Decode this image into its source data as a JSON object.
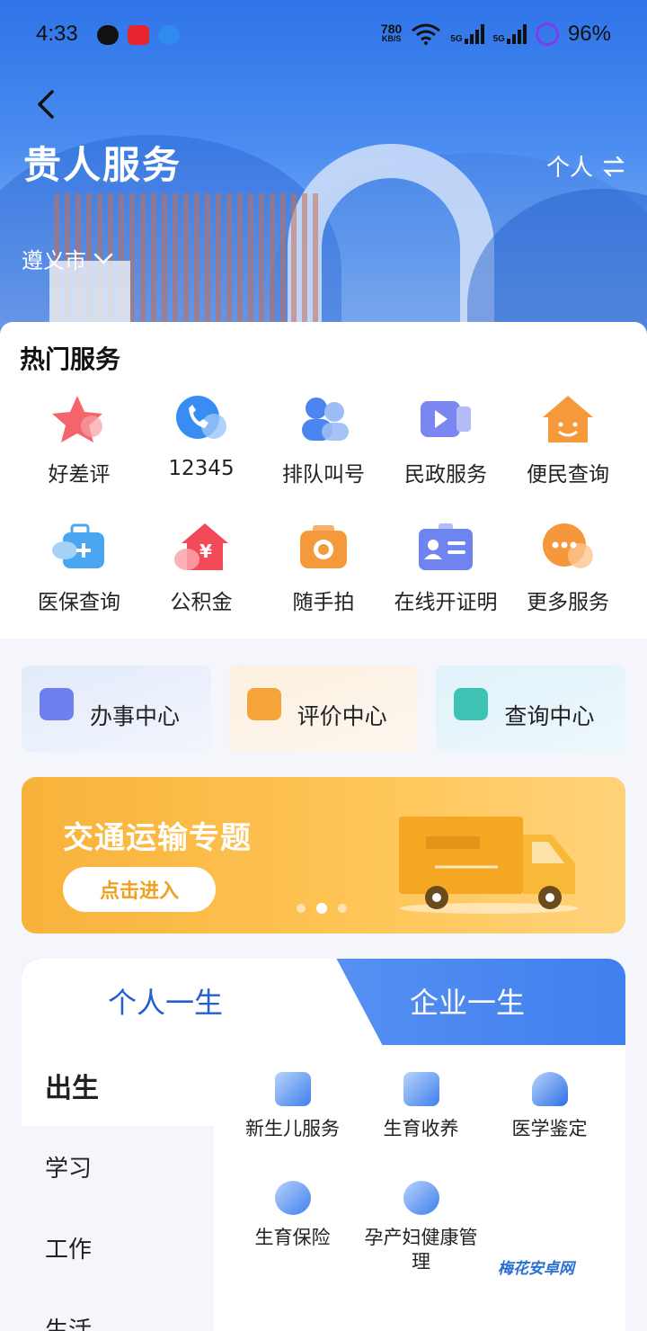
{
  "status_bar": {
    "time": "4:33",
    "net_speed_value": "780",
    "net_speed_unit": "KB/S",
    "signal_1": "5G",
    "signal_2": "5G",
    "battery": "96%"
  },
  "header": {
    "title": "贵人服务",
    "switch_label": "个人",
    "city": "遵义市"
  },
  "hot_services": {
    "title": "热门服务",
    "items": [
      {
        "label": "好差评",
        "icon": "star-icon",
        "color": "#f2545b"
      },
      {
        "label": "12345",
        "icon": "phone-icon",
        "color": "#3a8cf5"
      },
      {
        "label": "排队叫号",
        "icon": "queue-icon",
        "color": "#4b86f0"
      },
      {
        "label": "民政服务",
        "icon": "video-icon",
        "color": "#7b86f0"
      },
      {
        "label": "便民查询",
        "icon": "house-smile-icon",
        "color": "#f59a3c"
      },
      {
        "label": "医保查询",
        "icon": "medical-kit-icon",
        "color": "#4aa6f0"
      },
      {
        "label": "公积金",
        "icon": "house-yuan-icon",
        "color": "#f24a58"
      },
      {
        "label": "随手拍",
        "icon": "camera-icon",
        "color": "#f59a3c"
      },
      {
        "label": "在线开证明",
        "icon": "id-card-icon",
        "color": "#6f84ef"
      },
      {
        "label": "更多服务",
        "icon": "chat-more-icon",
        "color": "#f5973a"
      }
    ]
  },
  "centers": [
    {
      "label": "办事中心",
      "icon": "document-icon",
      "color": "#6f7ff0",
      "bg": "#eaf0fb"
    },
    {
      "label": "评价中心",
      "icon": "edit-icon",
      "color": "#f5a437",
      "bg": "#fdf3e7"
    },
    {
      "label": "查询中心",
      "icon": "search-doc-icon",
      "color": "#3cc3b4",
      "bg": "#e6f5fb"
    }
  ],
  "banner": {
    "title": "交通运输专题",
    "button": "点击进入"
  },
  "life": {
    "tabs": [
      "个人一生",
      "企业一生"
    ],
    "categories": [
      "出生",
      "学习",
      "工作",
      "生活"
    ],
    "items": [
      {
        "label": "新生儿服务",
        "icon": "baby-icon"
      },
      {
        "label": "生育收养",
        "icon": "family-icon"
      },
      {
        "label": "医学鉴定",
        "icon": "microscope-icon"
      },
      {
        "label": "生育保险",
        "icon": "insurance-icon"
      },
      {
        "label": "孕产妇健康管理",
        "icon": "health-plus-icon"
      }
    ]
  },
  "watermark": "梅花安卓网",
  "colors": {
    "primary": "#2f74e8",
    "tab_active_text": "#1f5fd0",
    "banner_bg": "#ffc556"
  }
}
